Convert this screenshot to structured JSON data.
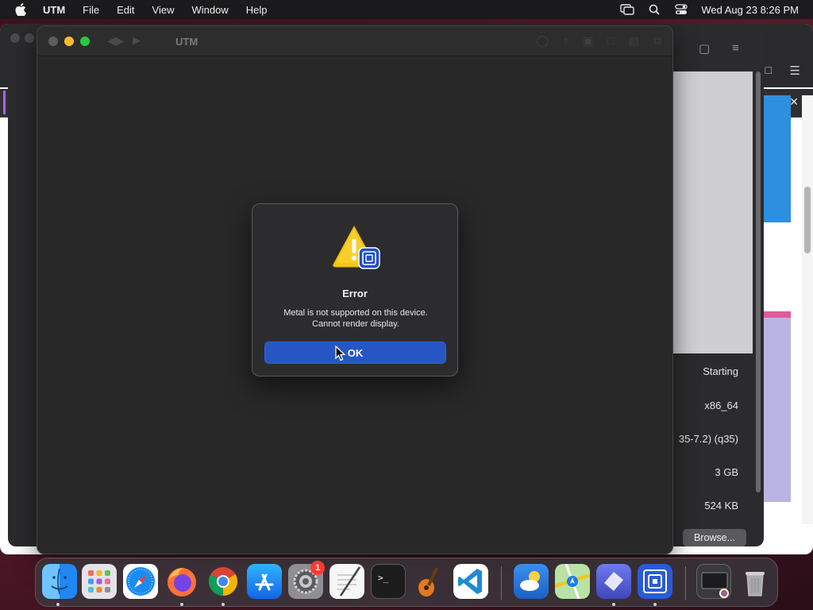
{
  "menubar": {
    "app_name": "UTM",
    "items": [
      "File",
      "Edit",
      "View",
      "Window",
      "Help"
    ],
    "clock": "Wed Aug 23  8:26 PM",
    "status_icons": [
      "screen-mirroring-icon",
      "spotlight-search-icon",
      "control-center-icon"
    ]
  },
  "vm_window": {
    "title": "UTM",
    "traffic_lights": [
      "close",
      "minimize",
      "maximize"
    ]
  },
  "dialog": {
    "title": "Error",
    "message_line1": "Metal is not supported on this device.",
    "message_line2": "Cannot render display.",
    "ok_label": "OK",
    "icon": "warning-icon"
  },
  "utm_details": {
    "status": "Starting",
    "architecture": "x86_64",
    "machine": "35-7.2) (q35)",
    "memory": "3 GB",
    "size": "524 KB",
    "browse_label": "Browse..."
  },
  "dock": {
    "apps": [
      {
        "name": "finder",
        "color": "#1e88f5"
      },
      {
        "name": "launchpad",
        "color": "#d9d9de"
      },
      {
        "name": "safari",
        "color": "#1a8cf0"
      },
      {
        "name": "firefox",
        "color": "#ff6d2c"
      },
      {
        "name": "chrome",
        "color": "#ffffff"
      },
      {
        "name": "app-store",
        "color": "#1d8cf5"
      },
      {
        "name": "system-settings",
        "color": "#8e8e93"
      },
      {
        "name": "textedit",
        "color": "#f5f5f5"
      },
      {
        "name": "terminal",
        "color": "#1c1c1c"
      },
      {
        "name": "garageband",
        "color": "#f08a2a"
      },
      {
        "name": "vscode",
        "color": "#ffffff"
      },
      {
        "name": "weather",
        "color": "#2f7de1"
      },
      {
        "name": "maps",
        "color": "#5bc45a"
      },
      {
        "name": "shortcut-app",
        "color": "#4c5bd4"
      },
      {
        "name": "utm",
        "color": "#2a5bd7"
      },
      {
        "name": "downloads-stack",
        "color": "#3a3a3a"
      },
      {
        "name": "trash",
        "color": "#9a9a9e"
      }
    ],
    "settings_badge": "1"
  }
}
